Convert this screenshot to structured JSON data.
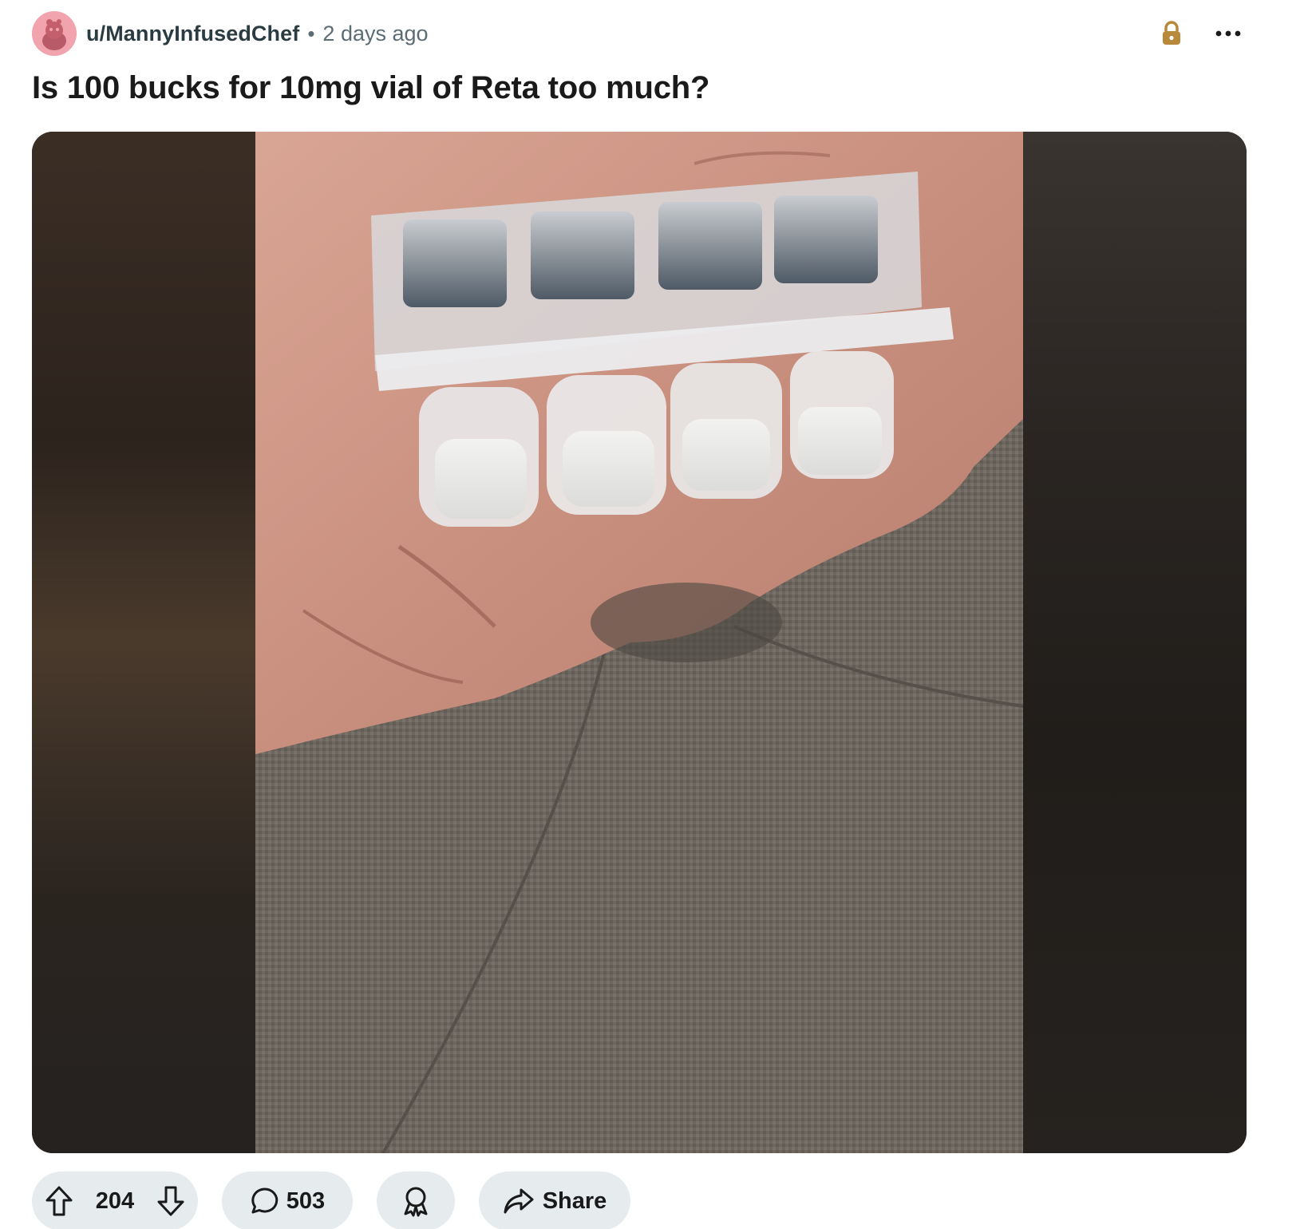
{
  "post": {
    "author": "u/MannyInfusedChef",
    "separator": "•",
    "time_ago": "2 days ago",
    "title": "Is 100 bucks for 10mg vial of Reta too much?"
  },
  "icons": {
    "avatar": "reddit-snoo-avatar",
    "lock": "lock-icon",
    "more": "more-options-icon",
    "upvote": "upvote-arrow-icon",
    "downvote": "downvote-arrow-icon",
    "comment": "comment-bubble-icon",
    "award": "award-icon",
    "share": "share-arrow-icon"
  },
  "actions": {
    "vote_count": "204",
    "comment_count": "503",
    "share_label": "Share"
  },
  "colors": {
    "avatar_bg": "#f4a6b0",
    "lock": "#b8893a",
    "pill_bg": "#e6ebee",
    "text_primary": "#1a1a1b",
    "text_secondary": "#5c6c74"
  }
}
